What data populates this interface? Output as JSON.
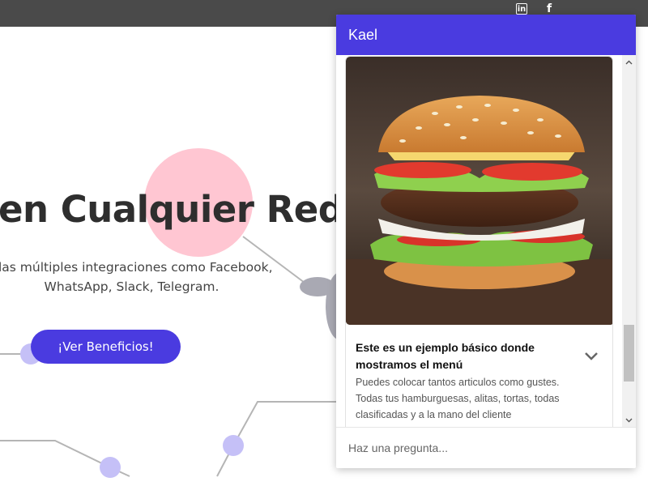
{
  "topbar": {
    "social": [
      {
        "icon": "linkedin-icon",
        "glyph": "in"
      },
      {
        "icon": "facebook-icon",
        "glyph": "f"
      }
    ]
  },
  "hero": {
    "title": "en Cualquier Red S",
    "subtitle_line1": "las múltiples integraciones como Facebook,",
    "subtitle_line2": "WhatsApp, Slack, Telegram.",
    "cta_label": "¡Ver Beneficios!"
  },
  "colors": {
    "accent": "#4a3be0",
    "topbar": "#4a4a4a",
    "pink_circle": "#ffc6d2",
    "lavender_dot": "#c5c0f7"
  },
  "chat": {
    "title": "Kael",
    "card": {
      "image": "burger-image",
      "title_line1": "Este es un ejemplo básico donde",
      "title_line2": "mostramos el menú",
      "desc_line1": "Puedes colocar tantos articulos como gustes.",
      "desc_line2": "Todas tus hamburguesas, alitas, tortas, todas",
      "desc_line3": "clasificadas y a la mano del cliente",
      "expand_icon": "chevron-down-icon"
    },
    "input_placeholder": "Haz una pregunta..."
  }
}
